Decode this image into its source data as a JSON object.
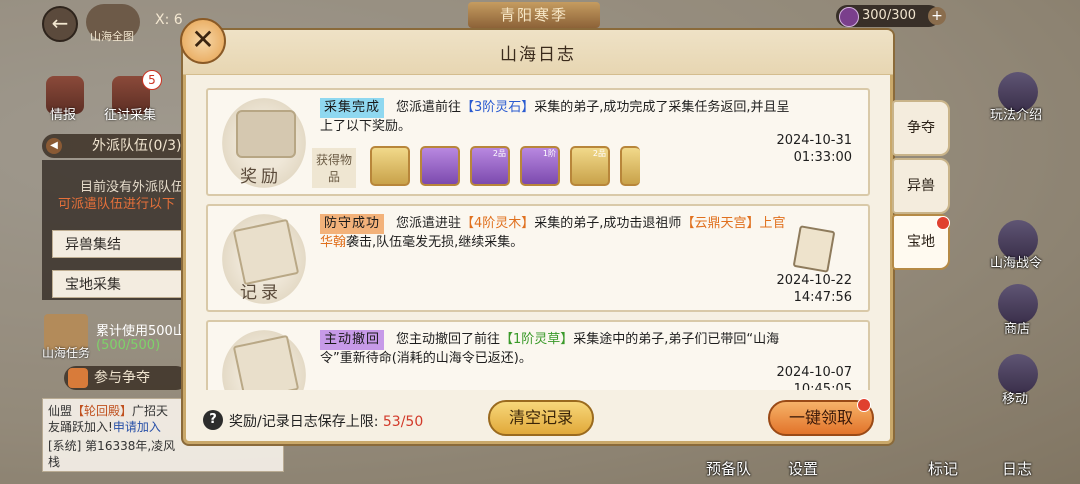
{
  "top": {
    "map_label": "山海全图",
    "coord_prefix": "X: 6",
    "season": "青阳寒季",
    "stamina": "300/300"
  },
  "left": {
    "intel_label": "情报",
    "campaign_label": "征讨采集",
    "campaign_badge": "5",
    "team_header": "外派队伍(0/3)",
    "team_empty_1": "目前没有外派队伍",
    "team_empty_2": "可派遣队伍进行以下",
    "team_items": [
      "异兽集结",
      "宝地采集"
    ],
    "token_label": "山海任务",
    "token_text_1": "累计使用500山",
    "token_text_2": "(500/500)",
    "join_label": "参与争夺",
    "chat": {
      "line1_prefix": "仙盟",
      "line1_tag": "【轮回殿】",
      "line1_text": "广招天",
      "line2_text": "友踊跃加入!",
      "line2_link": "申请加入",
      "line3_text": "[系统] 第16338年,凌风",
      "line4_text": "栈"
    }
  },
  "right": {
    "gameplay_intro": "玩法介绍",
    "shanhai_war": "山海战令",
    "shop": "商店",
    "move": "移动"
  },
  "bottom": {
    "reserve": "预备队",
    "settings": "设置",
    "mark": "标记",
    "log": "日志"
  },
  "modal": {
    "title": "山海日志",
    "close_glyph": "✕",
    "entries": [
      {
        "thumb_label": "奖励",
        "tag": "采集完成",
        "text_a": "您派遣前往",
        "highlight_a": "【3阶灵石】",
        "text_b": "采集的弟子,成功完成了采集任务返回,并且呈上了以下奖励。",
        "date": "2024-10-31",
        "time": "01:33:00",
        "obtained_label": "获得物品",
        "items": [
          {
            "name": "灵石",
            "sub": ""
          },
          {
            "name": "紫晶",
            "sub": ""
          },
          {
            "name": "蓝书",
            "sub": "2品"
          },
          {
            "name": "紫袋",
            "sub": "1阶"
          },
          {
            "name": "金书",
            "sub": "2品"
          },
          {
            "name": "物品",
            "sub": ""
          }
        ]
      },
      {
        "thumb_label": "记录",
        "tag": "防守成功",
        "text_a": "您派遣进驻",
        "highlight_a": "【4阶灵木】",
        "text_b": "采集的弟子,成功击退祖师",
        "highlight_b": "【云鼎天宫】上官华翰",
        "text_c": "袭击,队伍毫发无损,继续采集。",
        "date": "2024-10-22",
        "time": "14:47:56"
      },
      {
        "thumb_label": "记录",
        "tag": "主动撤回",
        "text_a": "您主动撤回了前往",
        "highlight_a": "【1阶灵草】",
        "text_b": "采集途中的弟子,弟子们已带回“山海令”重新待命(消耗的山海令已返还)。",
        "date": "2024-10-07",
        "time": "10:45:05"
      }
    ],
    "side_tabs": [
      "争夺",
      "异兽",
      "宝地"
    ],
    "footer_text": "奖励/记录日志保存上限:",
    "footer_count": "53/50",
    "clear_button": "清空记录",
    "claim_button": "一键领取"
  },
  "colors": {
    "tag_collect": "#8fd8f0",
    "tag_defense": "#f3b27a",
    "tag_withdraw": "#c79ae8",
    "highlight_blue": "#2a5bd0",
    "highlight_orange": "#e0701e",
    "highlight_green": "#3a9a2a"
  }
}
